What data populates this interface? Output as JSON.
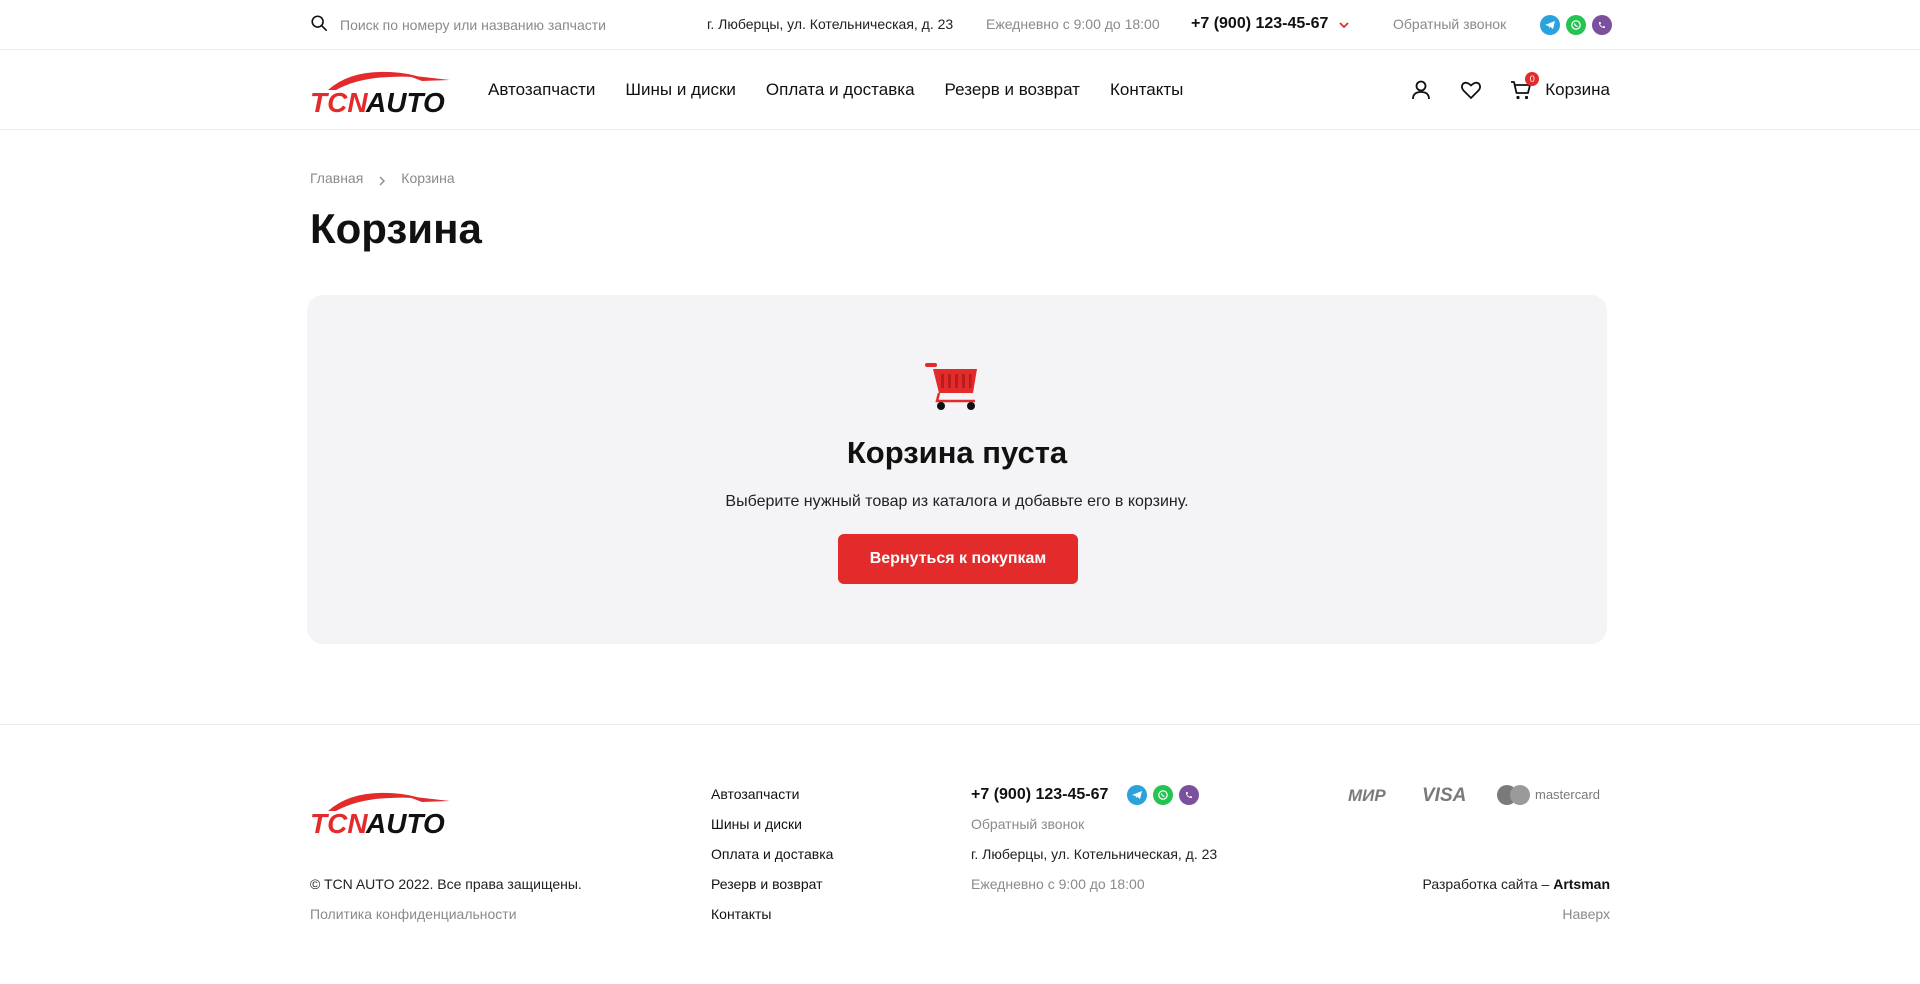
{
  "topbar": {
    "search_placeholder": "Поиск по номеру или названию запчасти",
    "address": "г. Люберцы, ул. Котельническая, д. 23",
    "hours": "Ежедневно с 9:00 до 18:00",
    "phone": "+7 (900) 123-45-67",
    "callback": "Обратный звонок",
    "messengers": [
      "telegram-icon",
      "whatsapp-icon",
      "viber-icon"
    ]
  },
  "brand": {
    "logo_text_red": "TCN",
    "logo_text_black": "AUTO",
    "accent_color": "#e32b2b"
  },
  "nav": {
    "items": [
      "Автозапчасти",
      "Шины и диски",
      "Оплата и доставка",
      "Резерв и возврат",
      "Контакты"
    ]
  },
  "header": {
    "cart_label": "Корзина",
    "cart_count": "0"
  },
  "breadcrumb": {
    "home": "Главная",
    "current": "Корзина"
  },
  "page": {
    "title": "Корзина"
  },
  "empty_cart": {
    "title": "Корзина пуста",
    "text": "Выберите нужный товар из каталога и добавьте его в корзину.",
    "button": "Вернуться к покупкам"
  },
  "footer": {
    "nav": [
      "Автозапчасти",
      "Шины и диски",
      "Оплата и доставка",
      "Резерв и возврат",
      "Контакты"
    ],
    "phone": "+7 (900) 123-45-67",
    "callback": "Обратный звонок",
    "address": "г. Люберцы, ул. Котельническая, д. 23",
    "hours": "Ежедневно с 9:00 до 18:00",
    "copyright": "© TCN AUTO 2022. Все права защищены.",
    "policy": "Политика конфиденциальности",
    "dev_prefix": "Разработка сайта – ",
    "dev_name": "Artsman",
    "to_top": "Наверх",
    "payment_methods": [
      "МИР",
      "VISA",
      "mastercard"
    ]
  }
}
